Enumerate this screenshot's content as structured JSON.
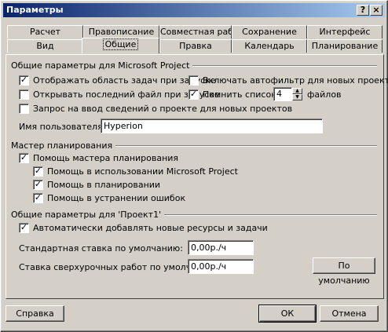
{
  "window": {
    "title": "Параметры",
    "help_btn": "?",
    "close_btn": "×"
  },
  "tabs_back": [
    "Расчет",
    "Правописание",
    "Совместная работа",
    "Сохранение",
    "Интерфейс"
  ],
  "tabs_front": [
    "Вид",
    "Общие",
    "Правка",
    "Календарь",
    "Планирование"
  ],
  "active_tab": "Общие",
  "general": {
    "group_title": "Общие параметры для Microsoft Project",
    "show_task_pane": {
      "label": "Отображать область задач при запуске",
      "checked": true
    },
    "autofilter": {
      "label": "Включать автофильтр для новых проектов",
      "checked": false
    },
    "open_last_file": {
      "label": "Открывать последний файл при запуске",
      "checked": false
    },
    "remember_list": {
      "label": "Помнить список из",
      "checked": true
    },
    "files_count": "4",
    "files_label": "файлов",
    "prompt_info": {
      "label": "Запрос на ввод сведений о проекте для новых проектов",
      "checked": false
    },
    "username_label": "Имя пользователя",
    "username_value": "Hyperion"
  },
  "wizard": {
    "group_title": "Мастер планирования",
    "assistant": {
      "label": "Помощь мастера планирования",
      "checked": true
    },
    "usage": {
      "label": "Помощь в использовании Microsoft Project",
      "checked": true
    },
    "planning": {
      "label": "Помощь в планировании",
      "checked": true
    },
    "errors": {
      "label": "Помощь в устранении ошибок",
      "checked": true
    }
  },
  "project": {
    "group_title": "Общие параметры для 'Проект1'",
    "auto_add": {
      "label": "Автоматически добавлять новые ресурсы и задачи",
      "checked": true
    },
    "std_rate_label": "Стандартная ставка по умолчанию:",
    "std_rate_value": "0,00р./ч",
    "ovt_rate_label": "Ставка сверхурочных работ по умолчанию",
    "ovt_rate_value": "0,00р./ч",
    "default_btn": "По умолчанию"
  },
  "footer": {
    "help": "Справка",
    "ok": "ОК",
    "cancel": "Отмена"
  }
}
